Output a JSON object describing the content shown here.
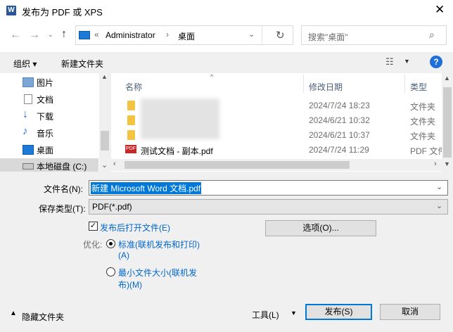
{
  "window": {
    "title": "发布为 PDF 或 XPS",
    "app_icon": "word-icon"
  },
  "nav": {
    "breadcrumb_prefix": "«",
    "breadcrumb": [
      "Administrator",
      "桌面"
    ],
    "search_placeholder": "搜索\"桌面\""
  },
  "toolbar": {
    "organize": "组织 ▾",
    "new_folder": "新建文件夹"
  },
  "sidebar": {
    "items": [
      {
        "label": "图片",
        "icon": "pictures-icon"
      },
      {
        "label": "文档",
        "icon": "documents-icon"
      },
      {
        "label": "下载",
        "icon": "download-icon"
      },
      {
        "label": "音乐",
        "icon": "music-icon"
      },
      {
        "label": "桌面",
        "icon": "desktop-icon"
      },
      {
        "label": "本地磁盘 (C:)",
        "icon": "drive-icon"
      }
    ]
  },
  "filelist": {
    "columns": [
      "名称",
      "修改日期",
      "类型"
    ],
    "rows": [
      {
        "name": "",
        "date": "2024/7/24 18:23",
        "type": "文件夹",
        "icon": "folder-icon"
      },
      {
        "name": "",
        "date": "2024/6/21 10:32",
        "type": "文件夹",
        "icon": "folder-icon"
      },
      {
        "name": "",
        "date": "2024/6/21 10:37",
        "type": "文件夹",
        "icon": "folder-icon"
      },
      {
        "name": "测试文档 - 副本.pdf",
        "date": "2024/7/24 11:29",
        "type": "PDF 文件",
        "icon": "pdf-icon"
      }
    ]
  },
  "form": {
    "filename_label": "文件名(N):",
    "filename_value": "新建 Microsoft Word 文档.pdf",
    "filetype_label": "保存类型(T):",
    "filetype_value": "PDF(*.pdf)",
    "open_after_publish": "发布后打开文件(E)",
    "open_after_publish_checked": true,
    "options_button": "选项(O)...",
    "optimize_label": "优化:",
    "optimize_standard_line1": "标准(联机发布和打印)",
    "optimize_standard_line2": "(A)",
    "optimize_min_line1": "最小文件大小(联机发",
    "optimize_min_line2": "布)(M)",
    "optimize_selected": "standard"
  },
  "footer": {
    "hide_folders": "隐藏文件夹",
    "tools": "工具(L)",
    "publish": "发布(S)",
    "cancel": "取消"
  },
  "colors": {
    "accent": "#0078d7",
    "link": "#0066cc",
    "selection": "#0078d7"
  }
}
